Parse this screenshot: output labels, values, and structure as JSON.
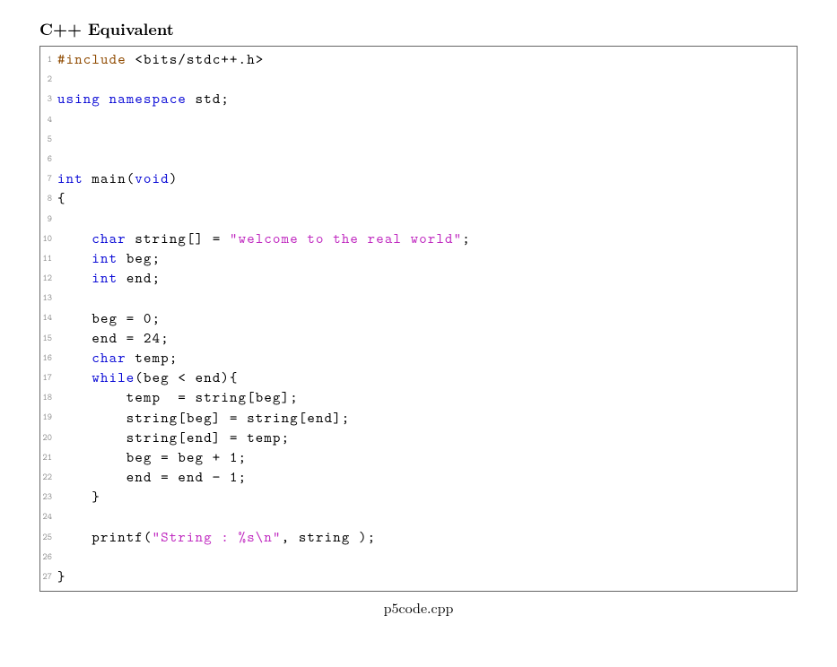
{
  "title": "C++ Equivalent",
  "caption": "p5code.cpp",
  "code": {
    "lines": [
      [
        {
          "cls": "tk-pp",
          "t": "#include"
        },
        {
          "cls": "",
          "t": " <bits/stdc++.h>"
        }
      ],
      [
        {
          "cls": "",
          "t": ""
        }
      ],
      [
        {
          "cls": "tk-kw",
          "t": "using"
        },
        {
          "cls": "",
          "t": " "
        },
        {
          "cls": "tk-kw",
          "t": "namespace"
        },
        {
          "cls": "",
          "t": " std;"
        }
      ],
      [
        {
          "cls": "",
          "t": ""
        }
      ],
      [
        {
          "cls": "",
          "t": ""
        }
      ],
      [
        {
          "cls": "",
          "t": ""
        }
      ],
      [
        {
          "cls": "tk-kw",
          "t": "int"
        },
        {
          "cls": "",
          "t": " main("
        },
        {
          "cls": "tk-kw",
          "t": "void"
        },
        {
          "cls": "",
          "t": ")"
        }
      ],
      [
        {
          "cls": "",
          "t": "{"
        }
      ],
      [
        {
          "cls": "",
          "t": ""
        }
      ],
      [
        {
          "cls": "",
          "t": "    "
        },
        {
          "cls": "tk-kw",
          "t": "char"
        },
        {
          "cls": "",
          "t": " string[] = "
        },
        {
          "cls": "tk-str",
          "t": "\"welcome to the real world\""
        },
        {
          "cls": "",
          "t": ";"
        }
      ],
      [
        {
          "cls": "",
          "t": "    "
        },
        {
          "cls": "tk-kw",
          "t": "int"
        },
        {
          "cls": "",
          "t": " beg;"
        }
      ],
      [
        {
          "cls": "",
          "t": "    "
        },
        {
          "cls": "tk-kw",
          "t": "int"
        },
        {
          "cls": "",
          "t": " end;"
        }
      ],
      [
        {
          "cls": "",
          "t": ""
        }
      ],
      [
        {
          "cls": "",
          "t": "    beg = 0;"
        }
      ],
      [
        {
          "cls": "",
          "t": "    end = 24;"
        }
      ],
      [
        {
          "cls": "",
          "t": "    "
        },
        {
          "cls": "tk-kw",
          "t": "char"
        },
        {
          "cls": "",
          "t": " temp;"
        }
      ],
      [
        {
          "cls": "",
          "t": "    "
        },
        {
          "cls": "tk-kw",
          "t": "while"
        },
        {
          "cls": "",
          "t": "(beg < end){"
        }
      ],
      [
        {
          "cls": "",
          "t": "        temp  = string[beg];"
        }
      ],
      [
        {
          "cls": "",
          "t": "        string[beg] = string[end];"
        }
      ],
      [
        {
          "cls": "",
          "t": "        string[end] = temp;"
        }
      ],
      [
        {
          "cls": "",
          "t": "        beg = beg + 1;"
        }
      ],
      [
        {
          "cls": "",
          "t": "        end = end − 1;"
        }
      ],
      [
        {
          "cls": "",
          "t": "    }"
        }
      ],
      [
        {
          "cls": "",
          "t": ""
        }
      ],
      [
        {
          "cls": "",
          "t": "    printf("
        },
        {
          "cls": "tk-str",
          "t": "\"String : %s\\n\""
        },
        {
          "cls": "",
          "t": ", string );"
        }
      ],
      [
        {
          "cls": "",
          "t": ""
        }
      ],
      [
        {
          "cls": "",
          "t": "}"
        }
      ]
    ]
  }
}
